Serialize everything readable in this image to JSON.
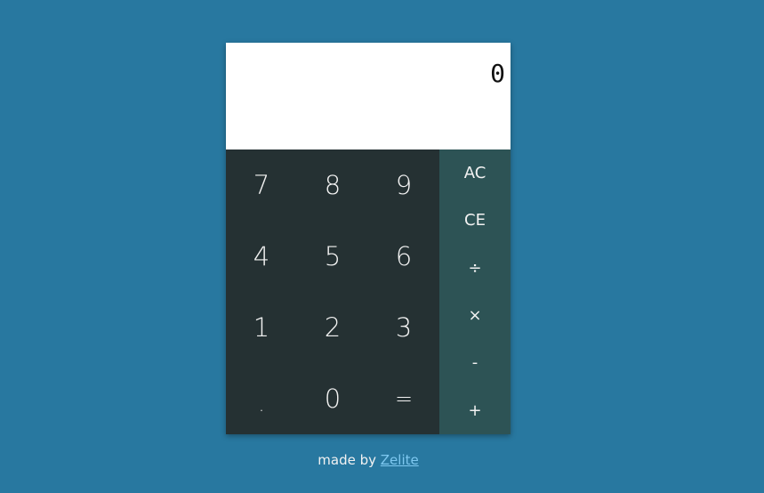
{
  "display": {
    "value": "0"
  },
  "keypad": {
    "keys": [
      "7",
      "8",
      "9",
      "4",
      "5",
      "6",
      "1",
      "2",
      "3",
      ".",
      "0",
      "="
    ]
  },
  "operators": {
    "keys": [
      "AC",
      "CE",
      "÷",
      "×",
      "-",
      "+"
    ]
  },
  "footer": {
    "prefix": "made by",
    "link_text": "Zelite"
  },
  "colors": {
    "background": "#2878a0",
    "keypad": "#253133",
    "operators": "#2d5355",
    "display": "#ffffff",
    "link": "#7ec8f0"
  }
}
